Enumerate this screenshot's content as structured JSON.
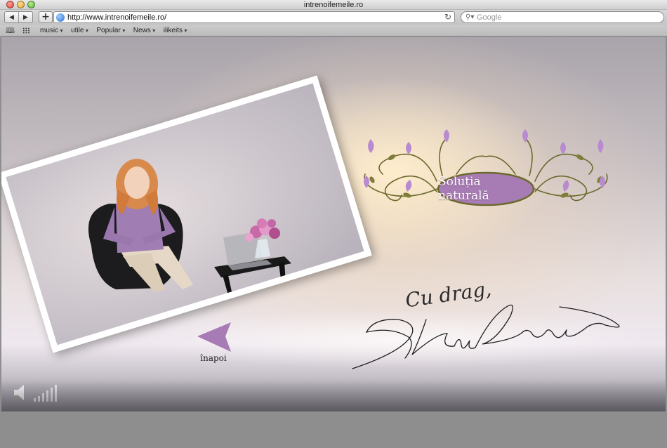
{
  "window": {
    "title": "intrenoifemeile.ro"
  },
  "toolbar": {
    "back_icon": "back-arrow-icon",
    "forward_icon": "forward-arrow-icon",
    "add_label": "+",
    "url": "http://www.intrenoifemeile.ro/",
    "reload_glyph": "↻",
    "search_placeholder": "Google"
  },
  "bookmarks": {
    "items": [
      {
        "label": "music"
      },
      {
        "label": "utile"
      },
      {
        "label": "Popular"
      },
      {
        "label": "News"
      },
      {
        "label": "ilikeits"
      }
    ]
  },
  "page": {
    "brand_title": "Soluția naturală",
    "signature_greeting": "Cu drag,",
    "back_label": "înapoi",
    "sound_icon": "speaker-icon",
    "volume_icon": "volume-bars-icon"
  },
  "colors": {
    "accent_purple": "#a77bb4",
    "ornament_olive": "#6b6a2e",
    "flower_violet": "#b88ad0"
  }
}
